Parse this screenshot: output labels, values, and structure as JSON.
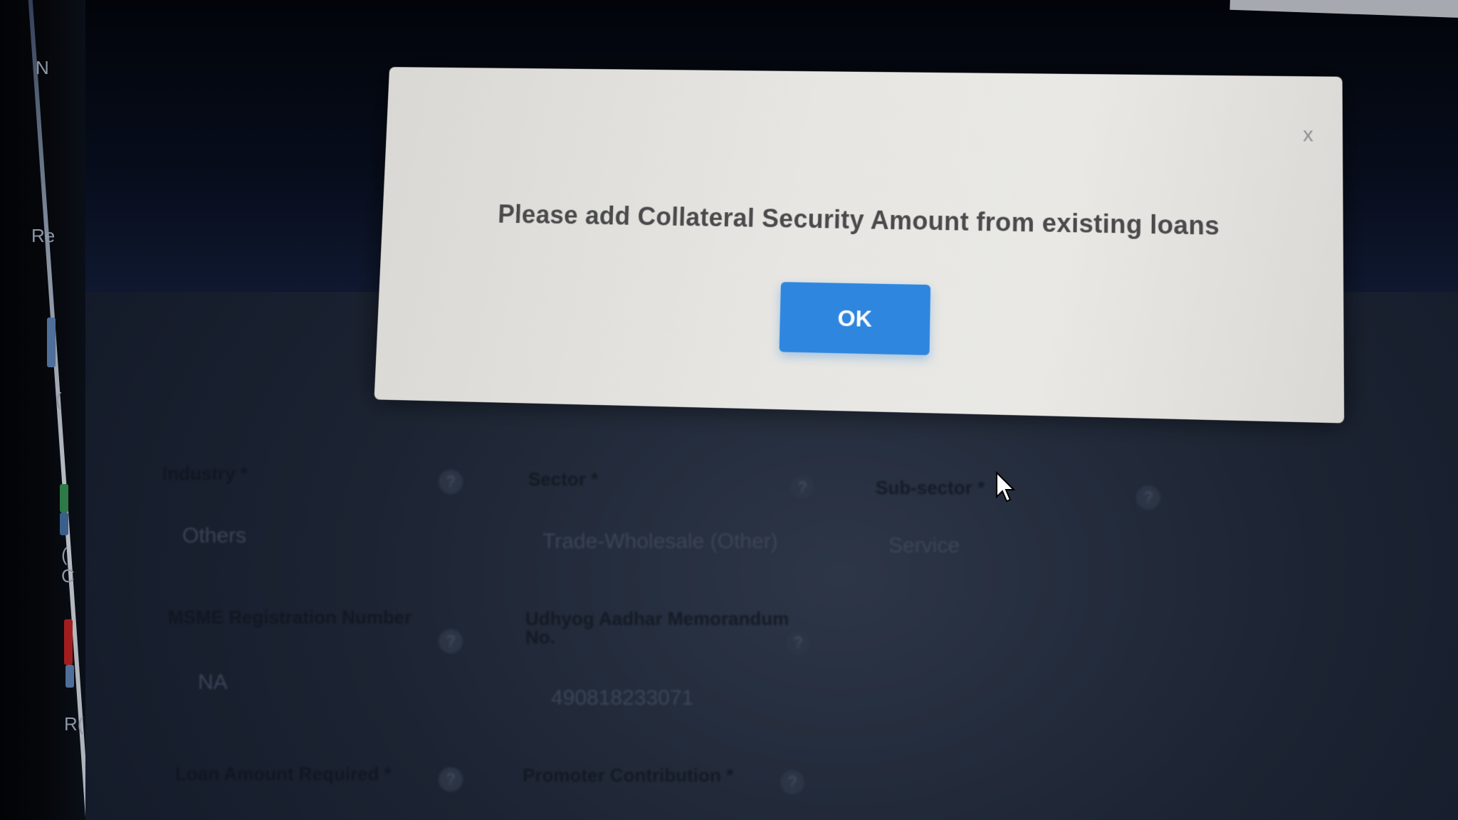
{
  "sidebar": {
    "fragments": [
      "N",
      "Re",
      "(",
      "(",
      "C",
      "R("
    ]
  },
  "form": {
    "fields": [
      {
        "label": "Industry *",
        "value": "Others"
      },
      {
        "label": "Sector *",
        "value": "Trade-Wholesale (Other)"
      },
      {
        "label": "Sub-sector *",
        "value": "Service"
      },
      {
        "label": "MSME Registration Number",
        "value": "NA"
      },
      {
        "label": "Udhyog Aadhar Memorandum No.",
        "value": "490818233071"
      },
      {
        "label": "Loan Amount Required *",
        "value": ""
      },
      {
        "label": "Promoter Contribution *",
        "value": ""
      }
    ],
    "help_symbol": "?"
  },
  "dialog": {
    "message": "Please add Collateral Security Amount from existing loans",
    "ok_label": "OK",
    "close_label": "x",
    "ok_color": "#2f86de"
  }
}
